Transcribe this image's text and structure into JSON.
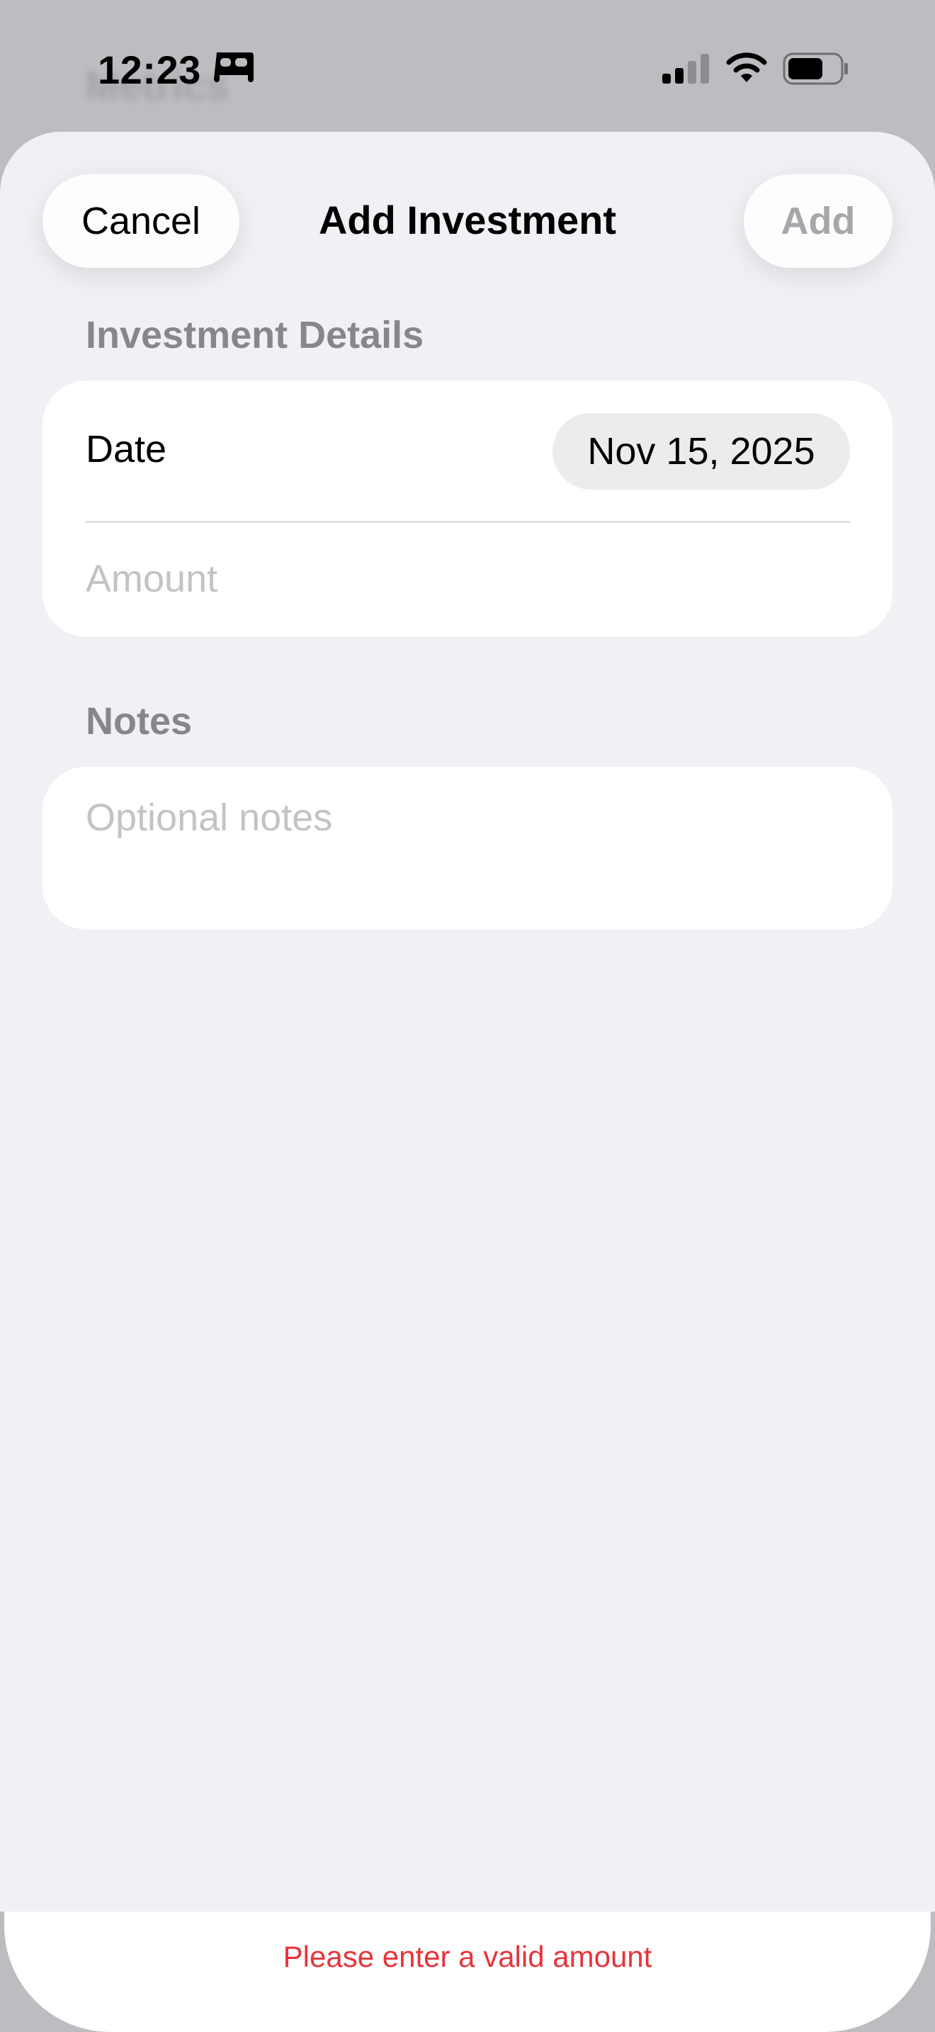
{
  "background": {
    "ghost_title": "Metrics"
  },
  "status_bar": {
    "time": "12:23",
    "icons": [
      "bed-icon",
      "cellular-signal-icon",
      "wifi-icon",
      "battery-icon"
    ]
  },
  "header": {
    "cancel_label": "Cancel",
    "title": "Add Investment",
    "add_label": "Add"
  },
  "details_section": {
    "header": "Investment Details",
    "date_label": "Date",
    "date_value": "Nov 15, 2025",
    "amount_placeholder": "Amount",
    "amount_value": ""
  },
  "notes_section": {
    "header": "Notes",
    "placeholder": "Optional notes",
    "value": ""
  },
  "footer": {
    "error_message": "Please enter a valid amount"
  },
  "colors": {
    "sheet_background": "#f0f0f5",
    "card_background": "#ffffff",
    "disabled_text": "#a7a7ab",
    "section_header": "#86868b",
    "error": "#e8343a"
  }
}
